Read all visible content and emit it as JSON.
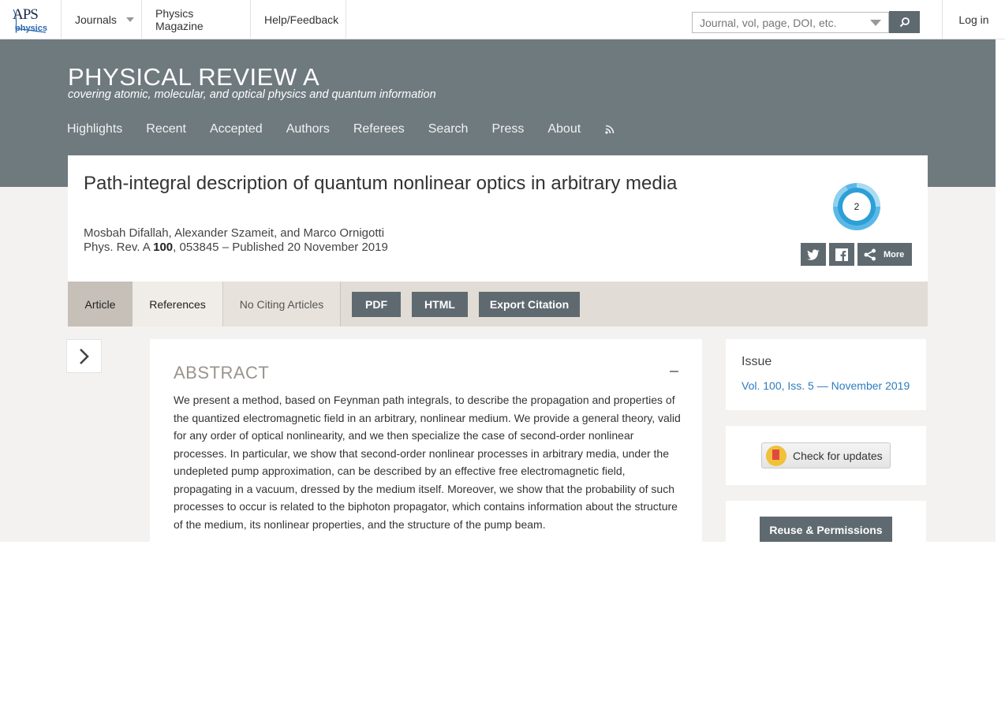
{
  "topbar": {
    "logo_aps": "APS",
    "logo_physics": "physics",
    "nav": [
      "Journals",
      "Physics Magazine",
      "Help/Feedback"
    ],
    "search_placeholder": "Journal, vol, page, DOI, etc.",
    "login": "Log in"
  },
  "journal": {
    "title": "PHYSICAL REVIEW A",
    "subtitle": "covering atomic, molecular, and optical physics and quantum information",
    "nav": [
      "Highlights",
      "Recent",
      "Accepted",
      "Authors",
      "Referees",
      "Search",
      "Press",
      "About"
    ]
  },
  "article": {
    "title": "Path-integral description of quantum nonlinear optics in arbitrary media",
    "authors": "Mosbah Difallah, Alexander Szameit, and Marco Ornigotti",
    "cite_prefix": "Phys. Rev. A ",
    "volume": "100",
    "cite_suffix": ", 053845 – Published 20 November 2019",
    "altmetric_count": "2",
    "share_more": "More"
  },
  "tabs": {
    "article": "Article",
    "references": "References",
    "citing": "No Citing Articles",
    "pdf": "PDF",
    "html": "HTML",
    "export": "Export Citation"
  },
  "abstract": {
    "heading": "ABSTRACT",
    "text": "We present a method, based on Feynman path integrals, to describe the propagation and properties of the quantized electromagnetic field in an arbitrary, nonlinear medium. We provide a general theory, valid for any order of optical nonlinearity, and we then specialize the case of second-order nonlinear processes. In particular, we show that second-order nonlinear processes in arbitrary media, under the undepleted pump approximation, can be described by an effective free electromagnetic field, propagating in a vacuum, dressed by the medium itself. Moreover, we show that the probability of such processes to occur is related to the biphoton propagator, which contains information about the structure of the medium, its nonlinear properties, and the structure of the pump beam."
  },
  "sidebar": {
    "issue_heading": "Issue",
    "issue_link": "Vol. 100, Iss. 5 — November 2019",
    "updates": "Check for updates",
    "permissions": "Reuse & Permissions"
  },
  "colors": {
    "band": "#6f7a7f",
    "button": "#5f6a70",
    "link": "#2e7bbf",
    "tabs_bg": "#e1dcd5"
  }
}
